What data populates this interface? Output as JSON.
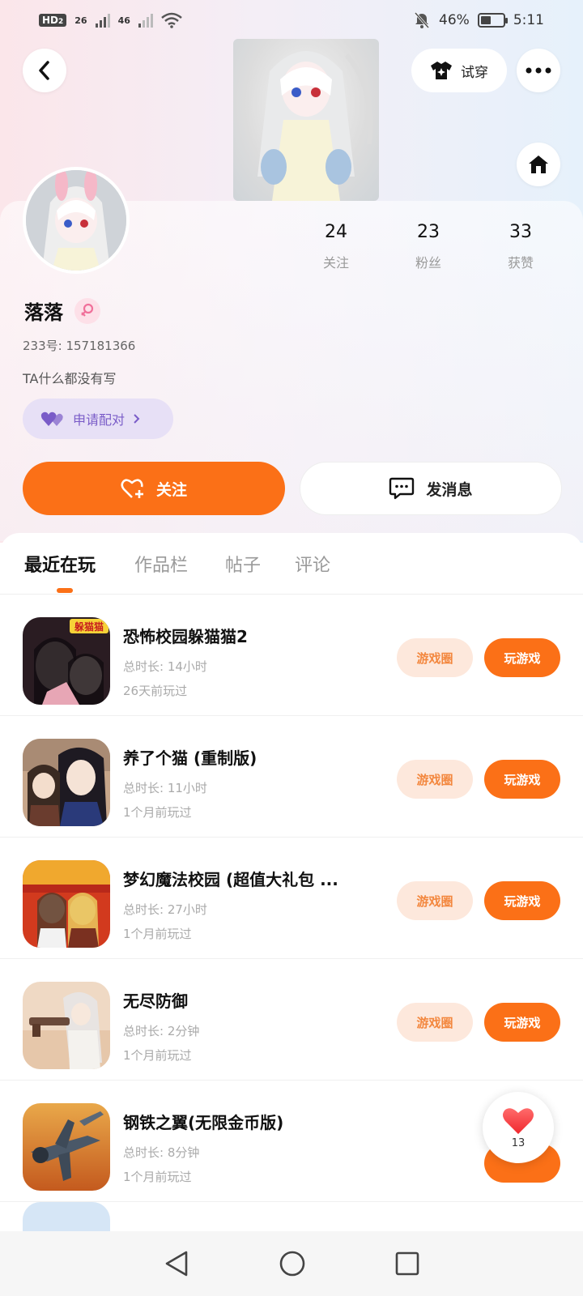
{
  "status_bar": {
    "hd": "HD",
    "hd_sub": "2",
    "signal1": "26",
    "signal2": "46",
    "battery": "46%",
    "time": "5:11",
    "battery_level": 0.46
  },
  "header": {
    "try_on_label": "试穿"
  },
  "profile": {
    "following_count": "24",
    "following_label": "关注",
    "fans_count": "23",
    "fans_label": "粉丝",
    "likes_count": "33",
    "likes_label": "获赞",
    "nickname": "落落",
    "uid": "233号: 157181366",
    "bio": "TA什么都没有写",
    "pair_label": "申请配对"
  },
  "actions": {
    "follow_label": "关注",
    "message_label": "发消息"
  },
  "tabs": [
    {
      "label": "最近在玩"
    },
    {
      "label": "作品栏"
    },
    {
      "label": "帖子"
    },
    {
      "label": "评论"
    }
  ],
  "games": [
    {
      "title": "恐怖校园躲猫猫2",
      "duration": "总时长: 14小时",
      "last_played": "26天前玩过",
      "circle_label": "游戏圈",
      "play_label": "玩游戏"
    },
    {
      "title": "养了个猫 (重制版)",
      "duration": "总时长: 11小时",
      "last_played": "1个月前玩过",
      "circle_label": "游戏圈",
      "play_label": "玩游戏"
    },
    {
      "title": "梦幻魔法校园 (超值大礼包 ...",
      "duration": "总时长: 27小时",
      "last_played": "1个月前玩过",
      "circle_label": "游戏圈",
      "play_label": "玩游戏"
    },
    {
      "title": "无尽防御",
      "duration": "总时长: 2分钟",
      "last_played": "1个月前玩过",
      "circle_label": "游戏圈",
      "play_label": "玩游戏"
    },
    {
      "title": "钢铁之翼(无限金币版)",
      "duration": "总时长: 8分钟",
      "last_played": "1个月前玩过",
      "circle_label": "",
      "play_label": ""
    }
  ],
  "game1_icon_text": "躲猫猫",
  "like_fab": {
    "count": "13"
  },
  "colors": {
    "accent": "#fb7017",
    "pair": "#7a5cc8"
  }
}
